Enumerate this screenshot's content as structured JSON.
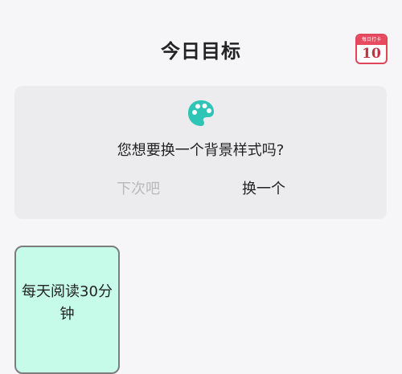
{
  "header": {
    "title": "今日目标",
    "calendar": {
      "icon": "calendar-icon",
      "month_label": "每日打卡",
      "day": "10"
    }
  },
  "prompt": {
    "icon": "palette-icon",
    "question": "您想要换一个背景样式吗?",
    "later_label": "下次吧",
    "change_label": "换一个"
  },
  "goals": [
    {
      "text": "每天阅读30分钟"
    }
  ],
  "colors": {
    "background": "#f6f6f8",
    "card": "#ececee",
    "accent_teal": "#2ec4b6",
    "calendar_red": "#e84a5f",
    "goal_card": "#c6fbea",
    "muted_text": "#b9b9bc"
  }
}
